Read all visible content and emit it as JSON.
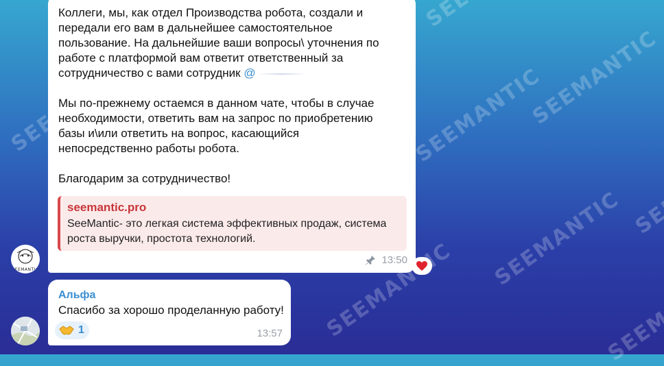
{
  "watermark": {
    "text": "SEEMANTIC"
  },
  "message1": {
    "text_main": "Коллеги, мы, как отдел Производства робота, создали и\nпередали его вам в дальнейшее самостоятельное\nпользование. На дальнейшие ваши вопросы\\ уточнения по\nработе с платформой вам ответит ответственный за\nсотрудничество с вами сотрудник ",
    "mention": "@",
    "text_after": "\n\nМы по-прежнему остаемся в данном чате, чтобы в случае\nнеобходимости, ответить вам на запрос по приобретению\nбазы и\\или ответить на вопрос, касающийся\nнепосредственно работы робота.\n\nБлагодарим за сотрудничество!",
    "link_preview": {
      "site": "seemantic.pro",
      "description": "SeeMantic- это легкая система эффективных продаж, система роста выручки, простота технологий."
    },
    "time": "13:50",
    "pin_icon": "pin-icon",
    "reaction_icon": "heart-icon",
    "avatar_caption": "SEEMANTIC"
  },
  "message2": {
    "sender": "Альфа",
    "text": "Спасибо за хорошо проделанную работу!",
    "time": "13:57",
    "reaction": {
      "icon": "handshake-icon",
      "count": "1"
    }
  },
  "colors": {
    "accent": "#3a8ed1",
    "link_red": "#c8363a",
    "preview_bg": "#fbeaea"
  }
}
